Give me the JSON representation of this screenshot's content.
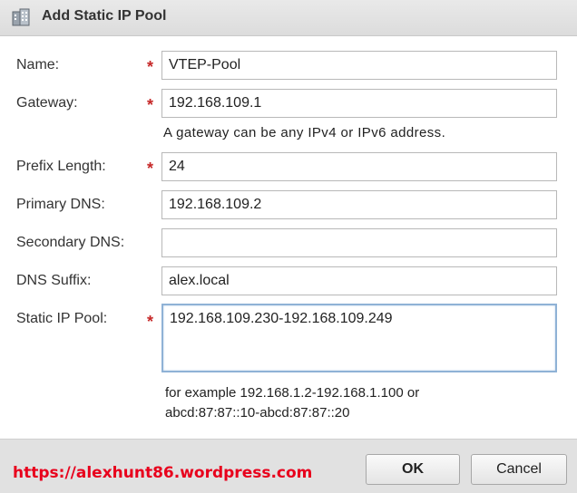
{
  "title_bar": {
    "title": "Add Static IP Pool",
    "icon": "building-icon"
  },
  "form": {
    "name": {
      "label": "Name:",
      "value": "VTEP-Pool",
      "required": true
    },
    "gateway": {
      "label": "Gateway:",
      "value": "192.168.109.1",
      "required": true,
      "hint": "A gateway can be any IPv4 or IPv6 address."
    },
    "prefix_length": {
      "label": "Prefix Length:",
      "value": "24",
      "required": true
    },
    "primary_dns": {
      "label": "Primary DNS:",
      "value": "192.168.109.2",
      "required": false
    },
    "secondary_dns": {
      "label": "Secondary DNS:",
      "value": "",
      "required": false
    },
    "dns_suffix": {
      "label": "DNS Suffix:",
      "value": "alex.local",
      "required": false
    },
    "static_ip_pool": {
      "label": "Static IP Pool:",
      "value": "192.168.109.230-192.168.109.249",
      "required": true,
      "hint_line1": "for example 192.168.1.2-192.168.1.100 or",
      "hint_line2": "abcd:87:87::10-abcd:87:87::20"
    },
    "required_marker": "*"
  },
  "footer": {
    "watermark": "https://alexhunt86.wordpress.com",
    "ok_label": "OK",
    "cancel_label": "Cancel"
  },
  "colors": {
    "required": "#c62828",
    "watermark": "#e8001c",
    "focus_border": "#8fb2d6"
  }
}
